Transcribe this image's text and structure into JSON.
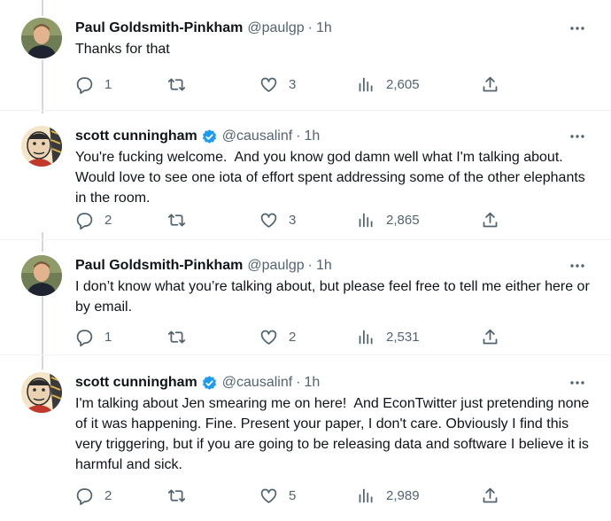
{
  "tweets": [
    {
      "name": "Paul Goldsmith-Pinkham",
      "handle": "@paulgp",
      "separator": "·",
      "time": "1h",
      "verified": false,
      "text": "Thanks for that",
      "replies": "1",
      "retweets": "",
      "likes": "3",
      "views": "2,605"
    },
    {
      "name": "scott cunningham",
      "handle": "@causalinf",
      "separator": "·",
      "time": "1h",
      "verified": true,
      "text": "You're fucking welcome.  And you know god damn well what I'm talking about.  Would love to see one iota of effort spent addressing some of the other elephants in the room.",
      "replies": "2",
      "retweets": "",
      "likes": "3",
      "views": "2,865"
    },
    {
      "name": "Paul Goldsmith-Pinkham",
      "handle": "@paulgp",
      "separator": "·",
      "time": "1h",
      "verified": false,
      "text": "I don’t know what you’re talking about, but please feel free to tell me either here or by email.",
      "replies": "1",
      "retweets": "",
      "likes": "2",
      "views": "2,531"
    },
    {
      "name": "scott cunningham",
      "handle": "@causalinf",
      "separator": "·",
      "time": "1h",
      "verified": true,
      "text": "I'm talking about Jen smearing me on here!  And EconTwitter just pretending none of it was happening. Fine. Present your paper, I don't care. Obviously I find this very triggering, but if you are going to be releasing data and software I believe it is harmful and sick.",
      "replies": "2",
      "retweets": "",
      "likes": "5",
      "views": "2,989"
    }
  ],
  "colors": {
    "text": "#0f1419",
    "secondary": "#536471",
    "verified": "#1d9bf0",
    "divider": "#eff3f4",
    "thread_line": "#cfd9de"
  },
  "icons": [
    "reply-icon",
    "retweet-icon",
    "like-icon",
    "views-icon",
    "share-icon",
    "more-icon",
    "verified-icon"
  ]
}
